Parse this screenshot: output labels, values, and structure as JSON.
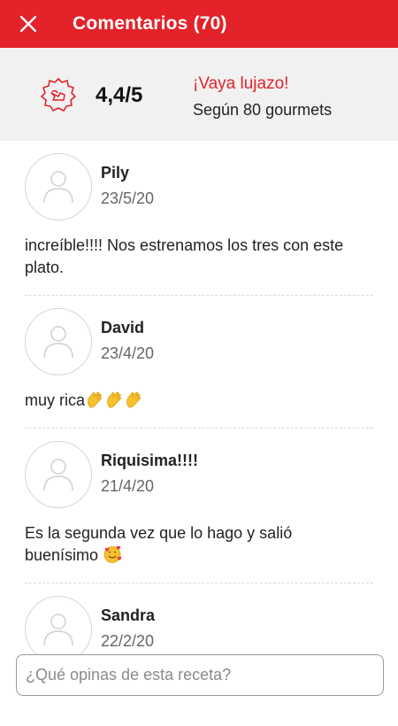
{
  "header": {
    "title": "Comentarios (70)",
    "close_icon": "close-icon",
    "color": "#e3222a"
  },
  "summary": {
    "badge_icon": "chef-hat-badge-icon",
    "score": "4,4/5",
    "praise": "¡Vaya lujazo!",
    "basis": "Según 80 gourmets"
  },
  "comments": [
    {
      "author": "Pily",
      "date": "23/5/20",
      "text": "increíble!!!! Nos estrenamos los tres con este plato.",
      "emojis": []
    },
    {
      "author": "David",
      "date": "23/4/20",
      "text": "muy rica",
      "emojis": [
        "clapping-hands",
        "clapping-hands",
        "clapping-hands"
      ]
    },
    {
      "author": "Riquisima!!!!",
      "date": "21/4/20",
      "text": "Es la segunda vez que lo hago y salió buenísimo",
      "emojis": [
        "smiling-face-with-hearts"
      ]
    },
    {
      "author": "Sandra",
      "date": "22/2/20",
      "text": "",
      "emojis": []
    }
  ],
  "input": {
    "placeholder": "¿Qué opinas de esta receta?"
  }
}
